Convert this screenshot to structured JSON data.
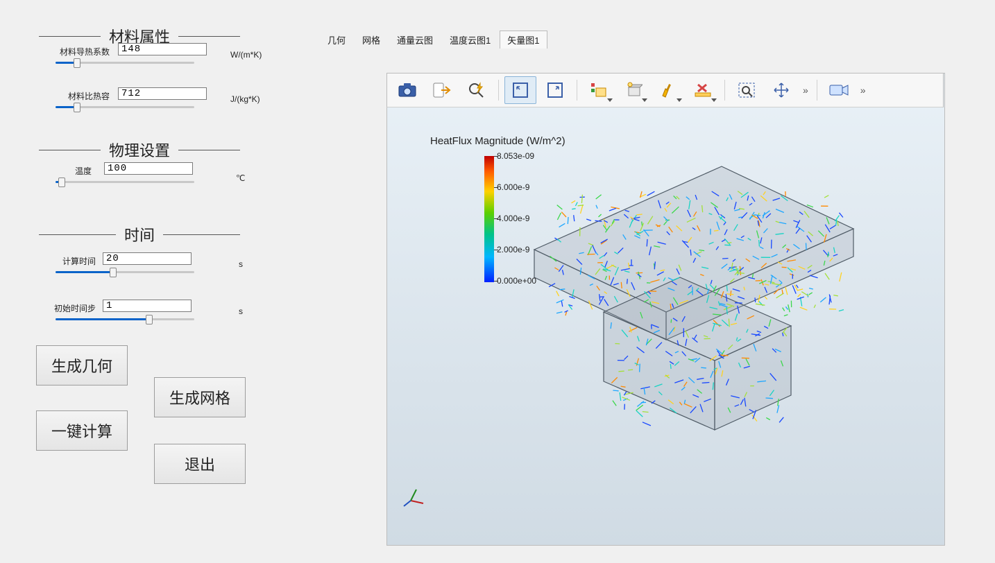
{
  "sections": {
    "material": {
      "title": "材料属性"
    },
    "physics": {
      "title": "物理设置"
    },
    "time": {
      "title": "时间"
    }
  },
  "params": {
    "conductivity": {
      "label": "材料导热系数",
      "value": "148",
      "unit": "W/(m*K)",
      "slider_pct": 14
    },
    "heatCapacity": {
      "label": "材料比热容",
      "value": "712",
      "unit": "J/(kg*K)",
      "slider_pct": 14
    },
    "temperature": {
      "label": "温度",
      "value": "100",
      "unit": "℃",
      "slider_pct": 3
    },
    "calcTime": {
      "label": "计算时间",
      "value": "20",
      "unit": "s",
      "slider_pct": 40
    },
    "initStep": {
      "label": "初始时间步",
      "value": "1",
      "unit": "s",
      "slider_pct": 66
    }
  },
  "buttons": {
    "genGeometry": "生成几何",
    "genMesh": "生成网格",
    "compute": "一键计算",
    "exit": "退出"
  },
  "tabs": [
    {
      "label": "几何",
      "active": false
    },
    {
      "label": "网格",
      "active": false
    },
    {
      "label": "通量云图",
      "active": false
    },
    {
      "label": "温度云图1",
      "active": false
    },
    {
      "label": "矢量图1",
      "active": true
    }
  ],
  "legend": {
    "title": "HeatFlux Magnitude (W/m^2)",
    "ticks": [
      "8.053e-09",
      "6.000e-9",
      "4.000e-9",
      "2.000e-9",
      "0.000e+00"
    ]
  },
  "toolbar_icons": [
    "camera-icon",
    "export-icon",
    "zoom-lightning-icon",
    "zoom-box-in-icon",
    "zoom-box-out-icon",
    "scene-menu-icon",
    "lighting-icon",
    "brush-icon",
    "dimension-x-icon",
    "zoom-select-icon",
    "pan-icon",
    "video-camera-icon"
  ]
}
